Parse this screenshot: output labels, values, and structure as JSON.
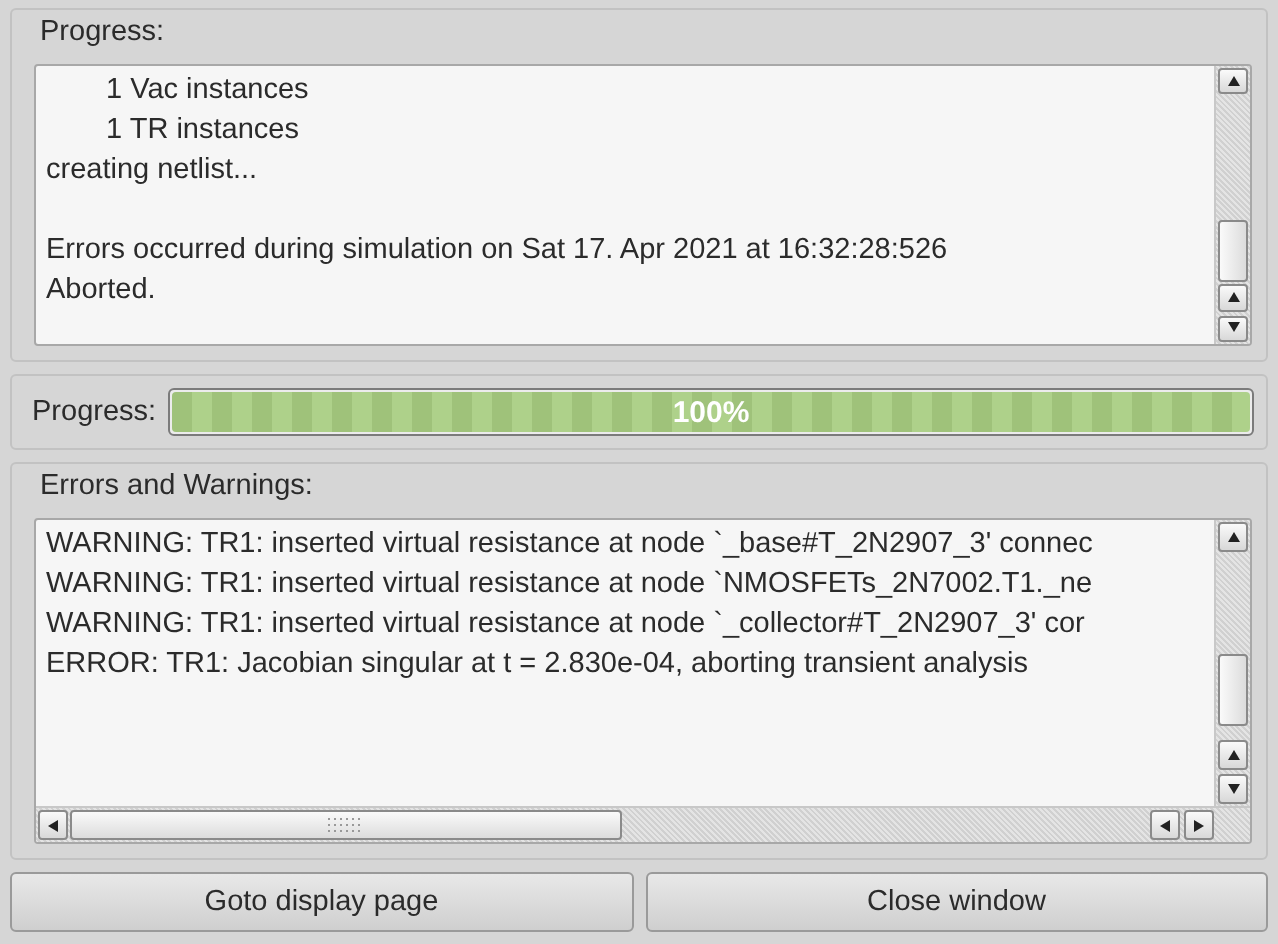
{
  "output_group": {
    "title": "Progress:",
    "lines": [
      {
        "text": "1 Vac instances",
        "indented": true,
        "gap_before": false
      },
      {
        "text": "1 TR instances",
        "indented": true,
        "gap_before": false
      },
      {
        "text": "creating netlist...",
        "indented": false,
        "gap_before": false
      },
      {
        "text": "Errors occurred during simulation on Sat 17. Apr 2021 at 16:32:28:526",
        "indented": false,
        "gap_before": true
      },
      {
        "text": "Aborted.",
        "indented": false,
        "gap_before": false
      }
    ]
  },
  "progress": {
    "label": "Progress:",
    "level": 1,
    "reading": "100%"
  },
  "errors_group": {
    "title": "Errors and Warnings:",
    "lines": [
      "WARNING: TR1: inserted virtual resistance at node `_base#T_2N2907_3' connec",
      "WARNING: TR1: inserted virtual resistance at node `NMOSFETs_2N7002.T1._ne",
      "WARNING: TR1: inserted virtual resistance at node `_collector#T_2N2907_3' cor",
      "ERROR: TR1: Jacobian singular at t = 2.830e-04, aborting transient analysis"
    ]
  },
  "buttons": [
    "Goto display page",
    "Close window"
  ]
}
